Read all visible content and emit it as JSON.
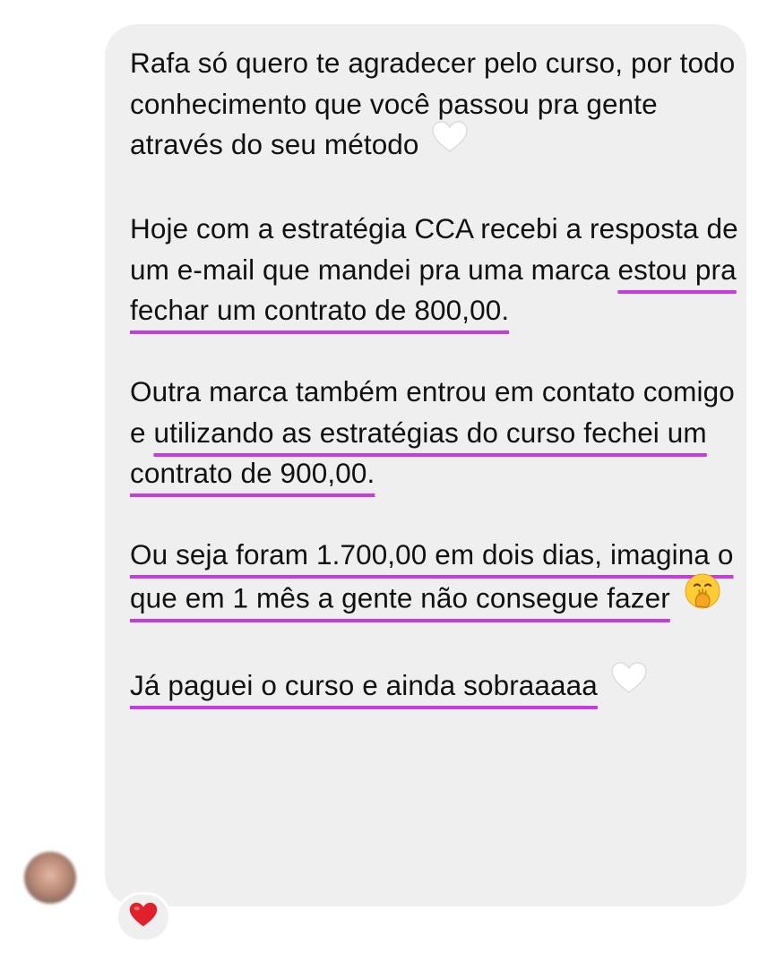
{
  "message": {
    "paragraphs": [
      {
        "segments": [
          {
            "text": "Rafa só quero te agradecer pelo curso, por todo conhecimento que você passou pra gente através do seu método",
            "highlight": false
          }
        ],
        "emoji": "white-heart-icon"
      },
      {
        "segments": [
          {
            "text": "Hoje com a estratégia CCA recebi a resposta de um e-mail que mandei pra uma marca ",
            "highlight": false
          },
          {
            "text": "estou pra fechar um contrato de 800,00.",
            "highlight": true
          }
        ]
      },
      {
        "segments": [
          {
            "text": "Outra marca também entrou em contato comigo e ",
            "highlight": false
          },
          {
            "text": "utilizando as estratégias do curso fechei um contrato de 900,00.",
            "highlight": true
          }
        ]
      },
      {
        "segments": [
          {
            "text": "Ou seja foram 1.700,00 em dois dias, imagina o que em 1 mês a gente não consegue fazer",
            "highlight": true
          }
        ],
        "emoji": "hand-over-mouth-emoji-icon"
      },
      {
        "segments": [
          {
            "text": "Já paguei o curso e ainda sobraaaaa",
            "highlight": true
          }
        ],
        "emoji": "white-heart-icon"
      }
    ],
    "reaction": "red-heart-icon"
  },
  "colors": {
    "bubble": "#efeff0",
    "text": "#111111",
    "highlight_underline": "#c43ddf",
    "reaction_heart": "#e0202a"
  }
}
